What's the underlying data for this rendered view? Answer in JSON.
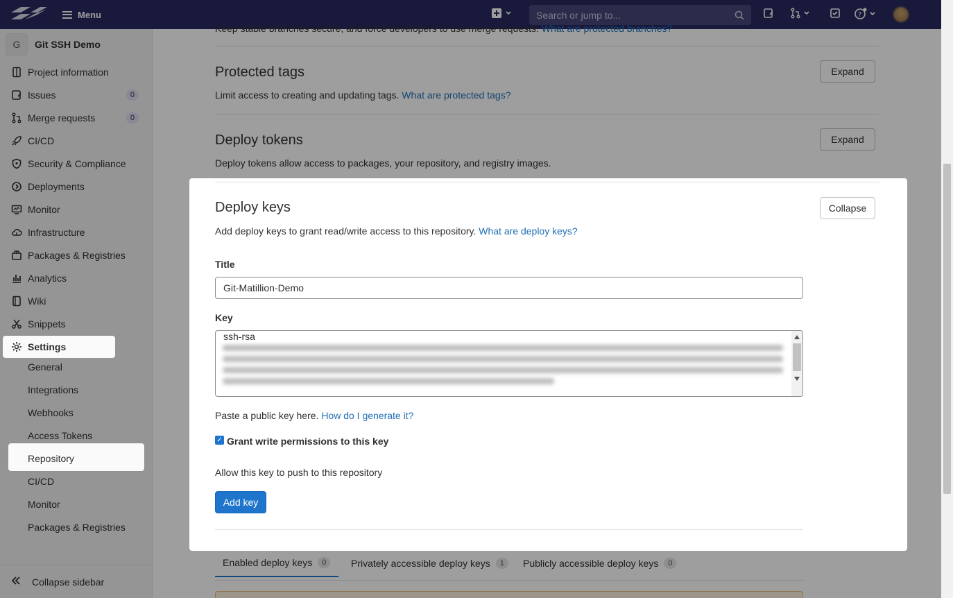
{
  "topbar": {
    "menu_label": "Menu",
    "search_placeholder": "Search or jump to..."
  },
  "sidebar": {
    "project_initial": "G",
    "project_name": "Git SSH Demo",
    "items": [
      {
        "label": "Project information",
        "icon": "document-icon"
      },
      {
        "label": "Issues",
        "icon": "issues-icon",
        "badge": "0"
      },
      {
        "label": "Merge requests",
        "icon": "merge-request-icon",
        "badge": "0"
      },
      {
        "label": "CI/CD",
        "icon": "rocket-icon"
      },
      {
        "label": "Security & Compliance",
        "icon": "shield-icon"
      },
      {
        "label": "Deployments",
        "icon": "deployments-icon"
      },
      {
        "label": "Monitor",
        "icon": "monitor-icon"
      },
      {
        "label": "Infrastructure",
        "icon": "cloud-icon"
      },
      {
        "label": "Packages & Registries",
        "icon": "package-icon"
      },
      {
        "label": "Analytics",
        "icon": "chart-icon"
      },
      {
        "label": "Wiki",
        "icon": "book-icon"
      },
      {
        "label": "Snippets",
        "icon": "scissors-icon"
      },
      {
        "label": "Settings",
        "icon": "gear-icon"
      }
    ],
    "settings_sub": [
      "General",
      "Integrations",
      "Webhooks",
      "Access Tokens",
      "Repository",
      "CI/CD",
      "Monitor",
      "Packages & Registries"
    ],
    "collapse_label": "Collapse sidebar"
  },
  "main": {
    "top_fragment": "Keep stable branches secure, and force developers to use merge requests.",
    "top_fragment_link": "What are protected branches?",
    "protected_tags": {
      "title": "Protected tags",
      "desc": "Limit access to creating and updating tags.",
      "link": "What are protected tags?",
      "button": "Expand"
    },
    "deploy_tokens": {
      "title": "Deploy tokens",
      "desc": "Deploy tokens allow access to packages, your repository, and registry images.",
      "button": "Expand"
    },
    "deploy_keys": {
      "title": "Deploy keys",
      "desc": "Add deploy keys to grant read/write access to this repository.",
      "link": "What are deploy keys?",
      "button": "Collapse",
      "title_label": "Title",
      "title_value": "Git-Matillion-Demo",
      "key_label": "Key",
      "key_value": "ssh-rsa",
      "paste_hint": "Paste a public key here.",
      "paste_link": "How do I generate it?",
      "checkbox_label": "Grant write permissions to this key",
      "checkbox_help": "Allow this key to push to this repository",
      "add_button": "Add key"
    },
    "tabs": [
      {
        "label": "Enabled deploy keys",
        "count": "0"
      },
      {
        "label": "Privately accessible deploy keys",
        "count": "1"
      },
      {
        "label": "Publicly accessible deploy keys",
        "count": "0"
      }
    ]
  }
}
